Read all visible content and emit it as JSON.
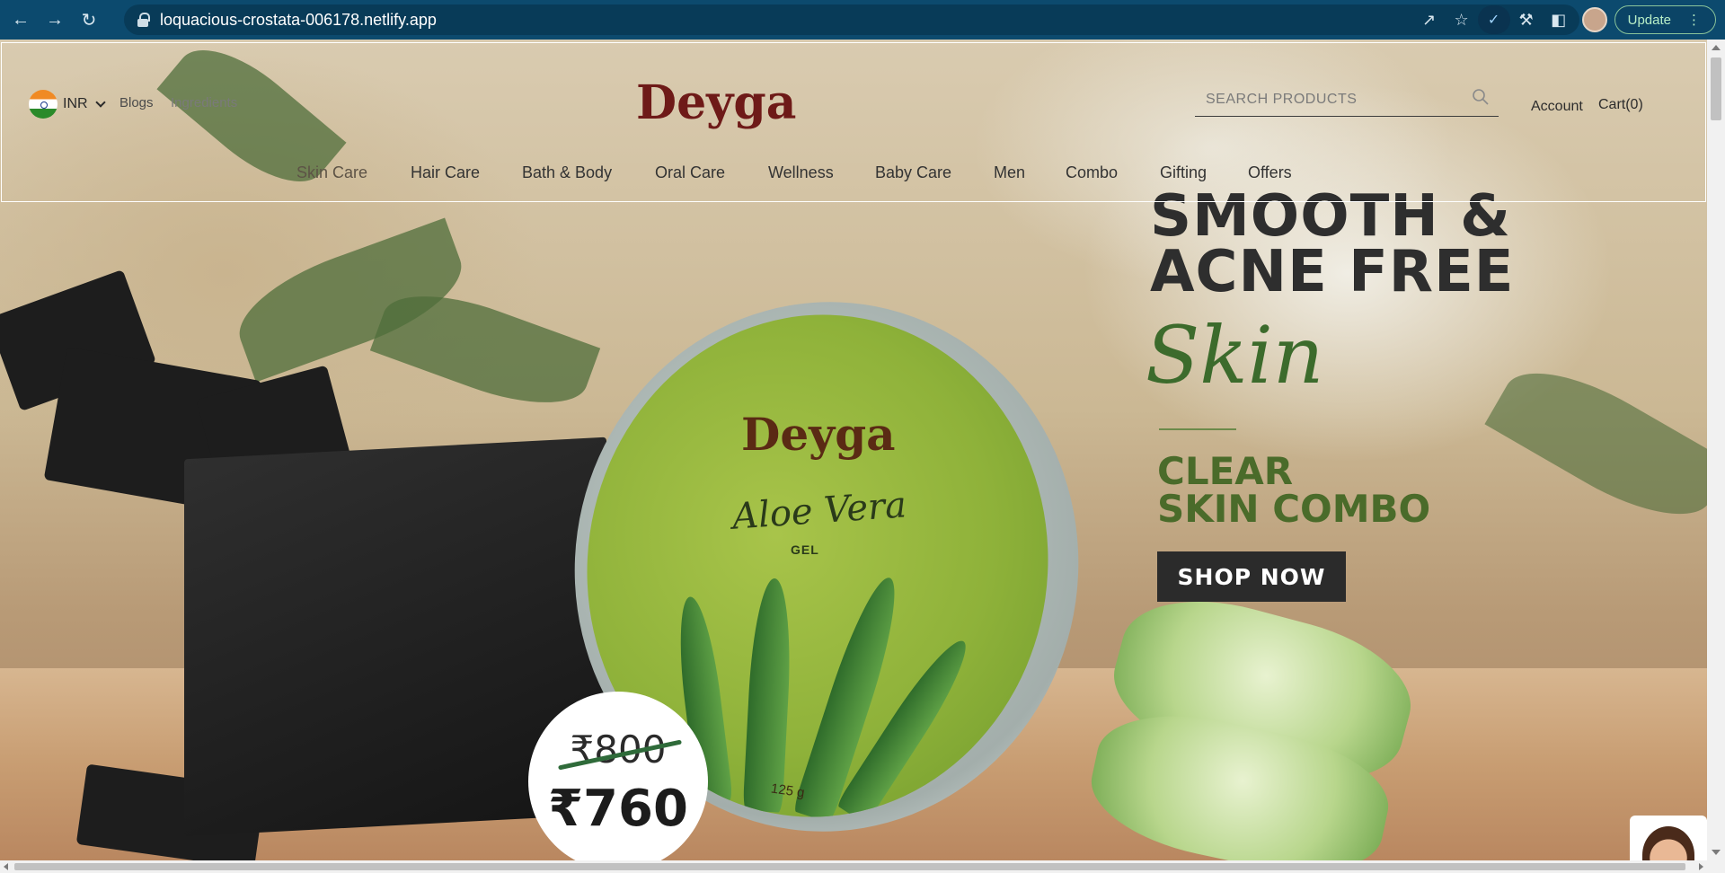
{
  "browser": {
    "url": "loquacious-crostata-006178.netlify.app",
    "update_label": "Update"
  },
  "header": {
    "currency": "INR",
    "links": [
      "Blogs",
      "Ingredients"
    ],
    "logo": "Deyga",
    "search_placeholder": "SEARCH PRODUCTS",
    "account": "Account",
    "cart": "Cart(0)",
    "nav": [
      "Skin Care",
      "Hair Care",
      "Bath & Body",
      "Oral Care",
      "Wellness",
      "Baby Care",
      "Men",
      "Combo",
      "Gifting",
      "Offers"
    ]
  },
  "hero": {
    "headline_1": "SMOOTH &",
    "headline_2": "ACNE FREE",
    "script": "Skin",
    "combo_1": "CLEAR",
    "combo_2": "SKIN COMBO",
    "cta": "SHOP NOW",
    "price_old": "₹800",
    "price_new": "₹760",
    "product": {
      "brand": "Deyga",
      "name": "Aloe Vera",
      "type": "GEL",
      "weight": "125 g"
    }
  },
  "colors": {
    "chrome": "#0c4a6e",
    "logo": "#6e1a18",
    "accent_green": "#4a6b2a",
    "cta_bg": "#2b2b2b"
  }
}
